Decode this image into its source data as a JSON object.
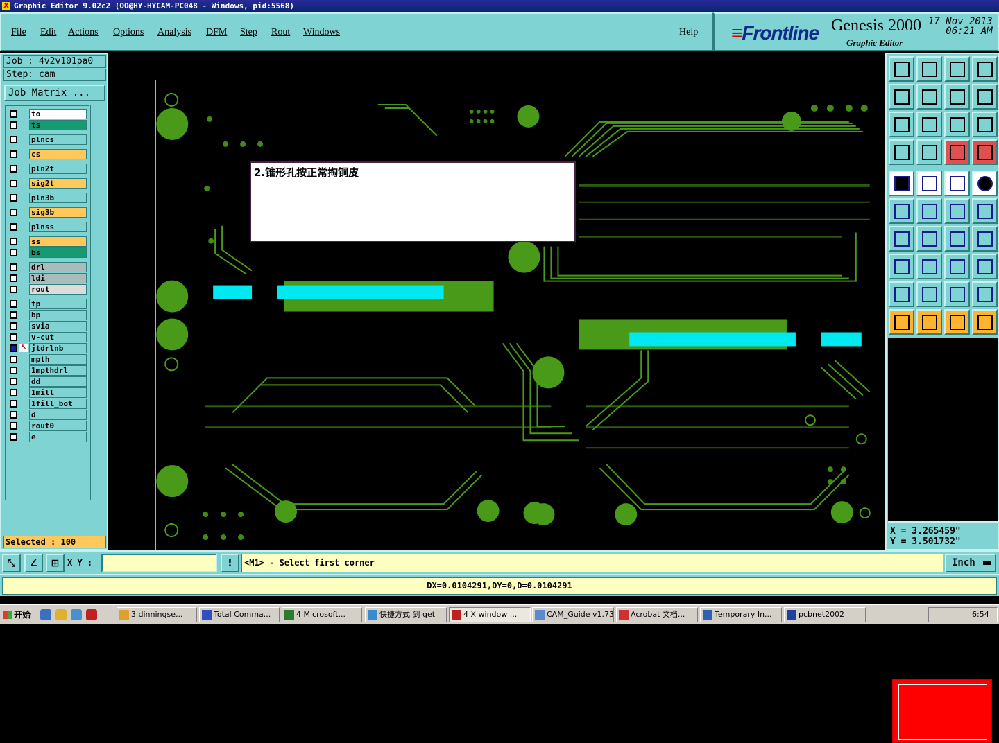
{
  "window": {
    "title": "Graphic Editor 9.02c2 (OO@HY-HYCAM-PC048 - Windows, pid:5568)"
  },
  "menu": {
    "items": [
      {
        "key": "file",
        "label": "File"
      },
      {
        "key": "edit",
        "label": "Edit"
      },
      {
        "key": "actions",
        "label": "Actions"
      },
      {
        "key": "options",
        "label": "Options"
      },
      {
        "key": "analysis",
        "label": "Analysis"
      },
      {
        "key": "dfm",
        "label": "DFM"
      },
      {
        "key": "step",
        "label": "Step"
      },
      {
        "key": "rout",
        "label": "Rout"
      },
      {
        "key": "windows",
        "label": "Windows"
      }
    ],
    "help": "Help"
  },
  "brand": {
    "logo": "Frontline",
    "product": "Genesis 2000",
    "subtitle": "Graphic Editor",
    "date": "17 Nov 2013",
    "time": "06:21 AM"
  },
  "job": {
    "label": "Job : 4v2v101pa0",
    "step": "Step: cam",
    "matrix_button": "Job Matrix ..."
  },
  "layers": [
    {
      "name": "to",
      "color": "#ffffff"
    },
    {
      "name": "ts",
      "color": "#169a72"
    },
    {
      "name": "plncs",
      "color": "#7fd3d2"
    },
    {
      "name": "cs",
      "color": "#ffc85a"
    },
    {
      "name": "pln2t",
      "color": "#7fd3d2"
    },
    {
      "name": "sig2t",
      "color": "#ffc85a"
    },
    {
      "name": "pln3b",
      "color": "#7fd3d2"
    },
    {
      "name": "sig3b",
      "color": "#ffc85a"
    },
    {
      "name": "plnss",
      "color": "#7fd3d2"
    },
    {
      "name": "ss",
      "color": "#ffc85a"
    },
    {
      "name": "bs",
      "color": "#169a72"
    },
    {
      "name": "drl",
      "color": "#a8bcbc"
    },
    {
      "name": "ldi",
      "color": "#a8bcbc"
    },
    {
      "name": "rout",
      "color": "#dcdcdc"
    },
    {
      "name": "tp",
      "color": "#7fd3d2"
    },
    {
      "name": "bp",
      "color": "#7fd3d2"
    },
    {
      "name": "svia",
      "color": "#7fd3d2"
    },
    {
      "name": "v-cut",
      "color": "#7fd3d2"
    },
    {
      "name": "jtdrlnb",
      "color": "#7fd3d2"
    },
    {
      "name": "mpth",
      "color": "#7fd3d2"
    },
    {
      "name": "1mpthdrl",
      "color": "#7fd3d2"
    },
    {
      "name": "dd",
      "color": "#7fd3d2"
    },
    {
      "name": "1mill",
      "color": "#7fd3d2"
    },
    {
      "name": "1fill_bot",
      "color": "#7fd3d2"
    },
    {
      "name": "d",
      "color": "#7fd3d2"
    },
    {
      "name": "rout0",
      "color": "#7fd3d2"
    },
    {
      "name": "e",
      "color": "#7fd3d2"
    }
  ],
  "selected": "Selected : 100",
  "note": "2.锥形孔按正常掏铜皮",
  "coords": {
    "x": "X = 3.265459\"",
    "y": "Y = 3.501732\""
  },
  "status": {
    "xy_label": "X Y :",
    "xy_value": "",
    "prompt": "<M1> - Select first corner",
    "unit": "Inch"
  },
  "measure": "DX=0.0104291,DY=0,D=0.0104291",
  "taskbar": {
    "start": "开始",
    "tasks": [
      {
        "label": "3 dinningse...",
        "icon": "#e0a030"
      },
      {
        "label": "Total Comma...",
        "icon": "#3050c0"
      },
      {
        "label": "4 Microsoft...",
        "icon": "#2a7a30"
      },
      {
        "label": "快捷方式 到 get",
        "icon": "#3a8ad0"
      },
      {
        "label": "4 X window ...",
        "icon": "#c02020"
      },
      {
        "label": "CAM_Guide v1.73",
        "icon": "#5a8ad0"
      },
      {
        "label": "Acrobat 文档...",
        "icon": "#d03030"
      },
      {
        "label": "Temporary In...",
        "icon": "#3060b0"
      },
      {
        "label": "pcbnet2002",
        "icon": "#2040a0"
      }
    ],
    "clock": "6:54"
  },
  "colors": {
    "panel": "#7fd3d2",
    "copper": "#4a9a1a",
    "pad": "#00e8f0",
    "note_border": "#4a1f44"
  }
}
